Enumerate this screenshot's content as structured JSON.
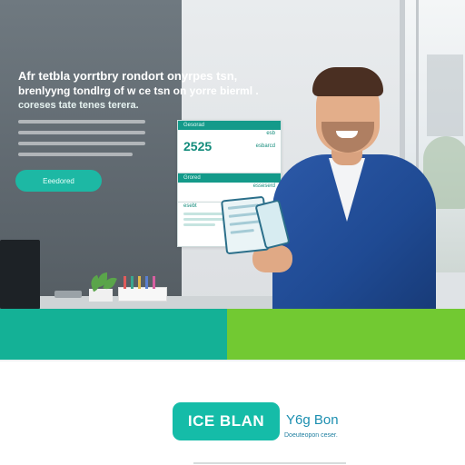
{
  "hero": {
    "headline_1": "Afr tetbla yorrtbry rondort onyrpes tsn,",
    "headline_2": "brenlyyng tondlrg of w ce tsn on yorre bierml .",
    "headline_3": "coreses tate tenes terera.",
    "cta_label": "Eeedored"
  },
  "cards": {
    "card1_head": "Gesorad",
    "card1_small_1": "esb",
    "card1_big": "2525",
    "card1_small_2": "esbarcd",
    "card2_head": "Grored",
    "card2_small": "esseserd",
    "card3_head": "esebt"
  },
  "brand": {
    "button_label": "ICE BLAN",
    "name": "Y6g Bon",
    "tagline": "Doeuteopon ceser."
  },
  "colors": {
    "teal": "#14b196",
    "green": "#72c932",
    "brand_teal": "#15bca8",
    "suit_blue": "#2c59a8"
  }
}
